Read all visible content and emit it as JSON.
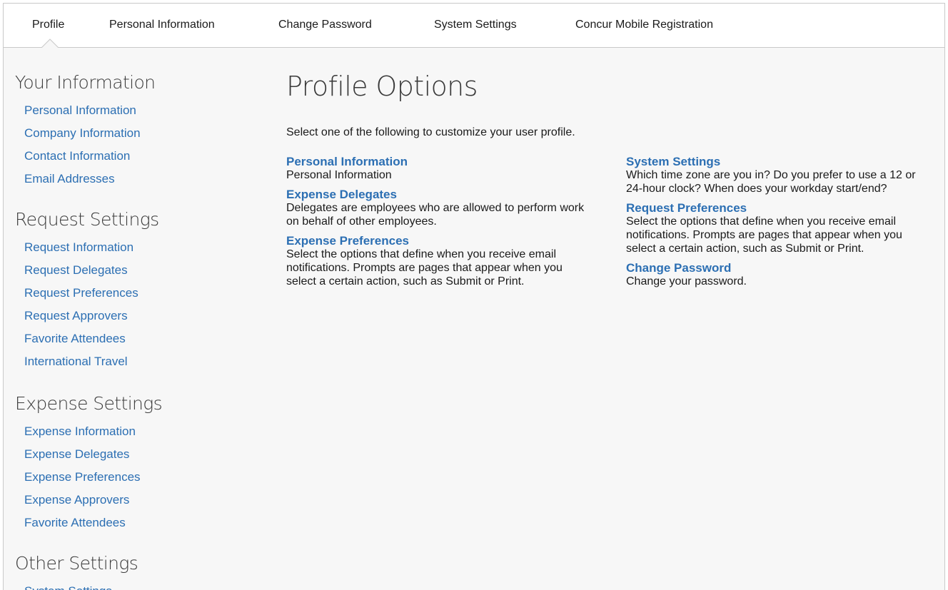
{
  "tabs": [
    {
      "label": "Profile"
    },
    {
      "label": "Personal Information"
    },
    {
      "label": "Change Password"
    },
    {
      "label": "System Settings"
    },
    {
      "label": "Concur Mobile Registration"
    }
  ],
  "sidebar": {
    "sections": [
      {
        "heading": "Your Information",
        "items": [
          "Personal Information",
          "Company Information",
          "Contact Information",
          "Email Addresses"
        ]
      },
      {
        "heading": "Request Settings",
        "items": [
          "Request Information",
          "Request Delegates",
          "Request Preferences",
          "Request Approvers",
          "Favorite Attendees",
          "International Travel"
        ]
      },
      {
        "heading": "Expense Settings",
        "items": [
          "Expense Information",
          "Expense Delegates",
          "Expense Preferences",
          "Expense Approvers",
          "Favorite Attendees"
        ]
      },
      {
        "heading": "Other Settings",
        "items": [
          "System Settings"
        ]
      }
    ]
  },
  "main": {
    "title": "Profile Options",
    "intro": "Select one of the following to customize your user profile.",
    "left_options": [
      {
        "title": "Personal Information",
        "desc": "Personal Information"
      },
      {
        "title": "Expense Delegates",
        "desc": "Delegates are employees who are allowed to perform work on behalf of other employees."
      },
      {
        "title": "Expense Preferences",
        "desc": "Select the options that define when you receive email notifications. Prompts are pages that appear when you select a certain action, such as Submit or Print."
      }
    ],
    "right_options": [
      {
        "title": "System Settings",
        "desc": "Which time zone are you in? Do you prefer to use a 12 or 24-hour clock? When does your workday start/end?"
      },
      {
        "title": "Request Preferences",
        "desc": "Select the options that define when you receive email notifications. Prompts are pages that appear when you select a certain action, such as Submit or Print."
      },
      {
        "title": "Change Password",
        "desc": "Change your password."
      }
    ]
  },
  "colors": {
    "link": "#2c6fb3",
    "panel_bg": "#f7f7f7"
  }
}
